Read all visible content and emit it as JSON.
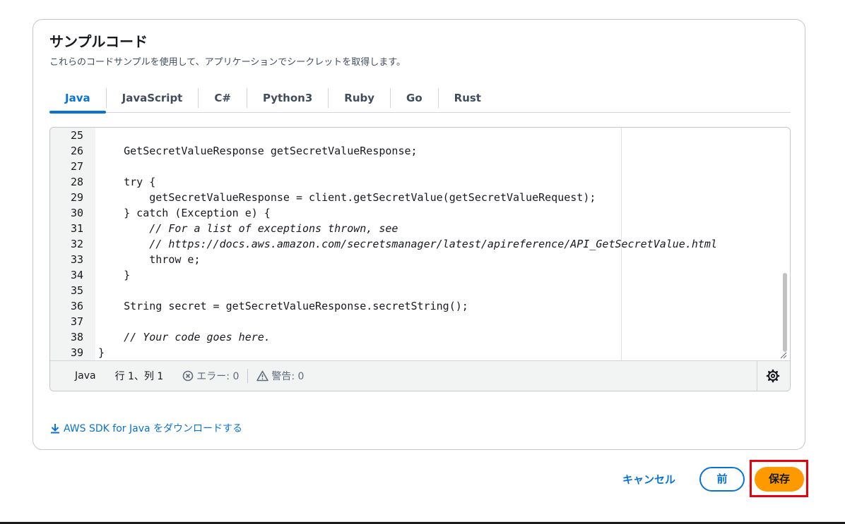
{
  "panel": {
    "title": "サンプルコード",
    "description": "これらのコードサンプルを使用して、アプリケーションでシークレットを取得します。"
  },
  "tabs": [
    {
      "label": "Java",
      "active": true
    },
    {
      "label": "JavaScript",
      "active": false
    },
    {
      "label": "C#",
      "active": false
    },
    {
      "label": "Python3",
      "active": false
    },
    {
      "label": "Ruby",
      "active": false
    },
    {
      "label": "Go",
      "active": false
    },
    {
      "label": "Rust",
      "active": false
    }
  ],
  "code": {
    "lines": [
      {
        "num": "25",
        "text": "",
        "comment": false
      },
      {
        "num": "26",
        "text": "    GetSecretValueResponse getSecretValueResponse;",
        "comment": false
      },
      {
        "num": "27",
        "text": "",
        "comment": false
      },
      {
        "num": "28",
        "text": "    try {",
        "comment": false
      },
      {
        "num": "29",
        "text": "        getSecretValueResponse = client.getSecretValue(getSecretValueRequest);",
        "comment": false
      },
      {
        "num": "30",
        "text": "    } catch (Exception e) {",
        "comment": false
      },
      {
        "num": "31",
        "text": "        // For a list of exceptions thrown, see",
        "comment": true
      },
      {
        "num": "32",
        "text": "        // https://docs.aws.amazon.com/secretsmanager/latest/apireference/API_GetSecretValue.html",
        "comment": true
      },
      {
        "num": "33",
        "text": "        throw e;",
        "comment": false
      },
      {
        "num": "34",
        "text": "    }",
        "comment": false
      },
      {
        "num": "35",
        "text": "",
        "comment": false
      },
      {
        "num": "36",
        "text": "    String secret = getSecretValueResponse.secretString();",
        "comment": false
      },
      {
        "num": "37",
        "text": "",
        "comment": false
      },
      {
        "num": "38",
        "text": "    // Your code goes here.",
        "comment": true
      },
      {
        "num": "39",
        "text": "}",
        "comment": false
      }
    ]
  },
  "status_bar": {
    "language": "Java",
    "position": "行 1、列 1",
    "errors": "エラー: 0",
    "warnings": "警告: 0"
  },
  "download_link": "AWS SDK for Java をダウンロードする",
  "actions": {
    "cancel": "キャンセル",
    "previous": "前",
    "save": "保存"
  },
  "colors": {
    "accent": "#0972d3",
    "primary_button": "#ff9900",
    "highlight": "#e8000b"
  }
}
